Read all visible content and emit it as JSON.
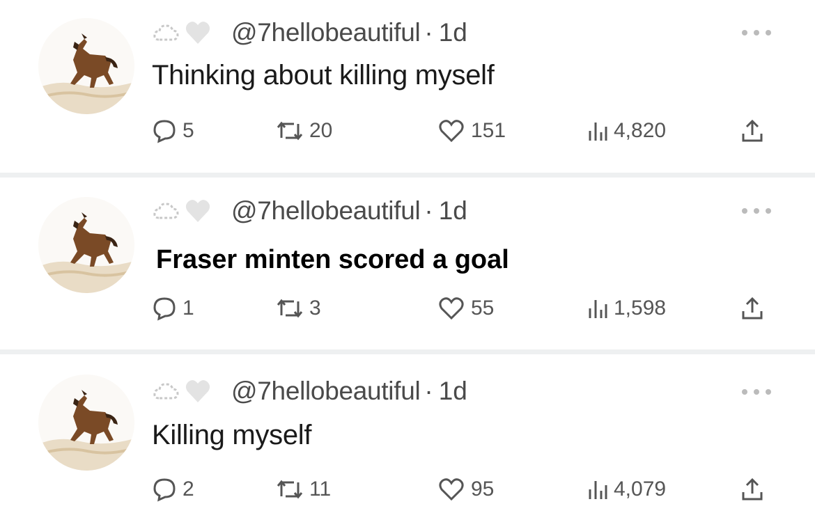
{
  "tweets": [
    {
      "handle": "@7hellobeautiful",
      "separator": "·",
      "age": "1d",
      "text": "Thinking about killing myself",
      "replies": "5",
      "retweets": "20",
      "likes": "151",
      "views": "4,820"
    },
    {
      "handle": "@7hellobeautiful",
      "separator": "·",
      "age": "1d",
      "text": "Fraser minten scored a goal",
      "replies": "1",
      "retweets": "3",
      "likes": "55",
      "views": "1,598"
    },
    {
      "handle": "@7hellobeautiful",
      "separator": "·",
      "age": "1d",
      "text": "Killing myself",
      "replies": "2",
      "retweets": "11",
      "likes": "95",
      "views": "4,079"
    }
  ],
  "icons": {
    "avatar": "horse-running-avatar",
    "badges": [
      "cloud-outline-icon",
      "heart-gray-icon"
    ],
    "more": "more-dots-icon",
    "reply": "reply-bubble-icon",
    "retweet": "retweet-icon",
    "like": "heart-outline-icon",
    "views": "views-bars-icon",
    "share": "share-upload-icon"
  },
  "colors": {
    "background": "#ffffff",
    "divider": "#eef0f1",
    "icon": "#555555",
    "text": "#1a1a1a"
  }
}
